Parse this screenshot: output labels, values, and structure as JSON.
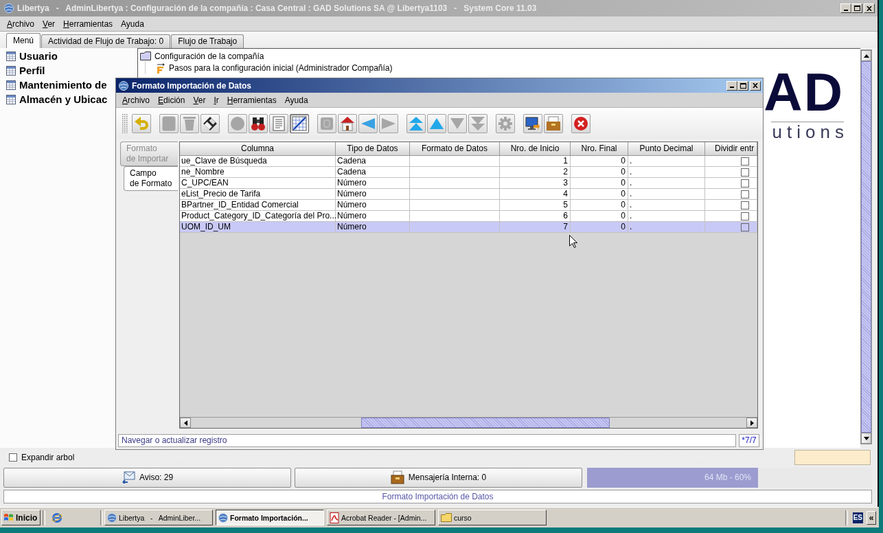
{
  "window": {
    "title": "Libertya   -   AdminLibertya : Configuración de la compañía : Casa Central : GAD Solutions SA @ Libertya1103   -   System Core 11.03",
    "active": false
  },
  "menu": [
    {
      "label": "Archivo",
      "mnemonic": true
    },
    {
      "label": "Ver",
      "mnemonic": true
    },
    {
      "label": "Herramientas",
      "mnemonic": true
    },
    {
      "label": "Ayuda",
      "mnemonic": false
    }
  ],
  "tabs": [
    {
      "label": "Menú",
      "selected": true
    },
    {
      "label": "Actividad de Flujo de Trabajo: 0",
      "selected": false
    },
    {
      "label": "Flujo de Trabajo",
      "selected": false
    }
  ],
  "sidebar": {
    "items": [
      {
        "label": "Usuario"
      },
      {
        "label": "Perfil"
      },
      {
        "label": "Mantenimiento de"
      },
      {
        "label": "Almacén y Ubicac"
      }
    ]
  },
  "tree": {
    "items": [
      {
        "label": "Configuración de la compañía",
        "kind": "folder",
        "children": [
          {
            "label": "Pasos para la configuración inicial (Administrador Compañía)",
            "kind": "workflow"
          }
        ]
      }
    ]
  },
  "logo": {
    "mark": "AD",
    "tagline": "utions"
  },
  "expand_tree": {
    "label": "Expandir arbol",
    "checked": false
  },
  "status_panels": [
    {
      "kind": "notice",
      "label": "Aviso: 29"
    },
    {
      "kind": "messages",
      "label": "Mensajería Interna: 0"
    }
  ],
  "memory": {
    "label": "64 Mb - 60%",
    "level": 0.6
  },
  "status_bar": "Formato Importación de Datos",
  "dialog": {
    "title": "Formato Importación de Datos",
    "active": true,
    "menu": [
      {
        "label": "Archivo",
        "mnemonic": true
      },
      {
        "label": "Edición",
        "mnemonic": true
      },
      {
        "label": "Ver",
        "mnemonic": true
      },
      {
        "label": "Ir",
        "mnemonic": true
      },
      {
        "label": "Herramientas",
        "mnemonic": true
      },
      {
        "label": "Ayuda",
        "mnemonic": false
      }
    ],
    "toolbar": [
      {
        "buttons": [
          {
            "kind": "undo",
            "disabled": false,
            "pressed": false
          }
        ]
      },
      {
        "buttons": [
          {
            "kind": "new",
            "disabled": true,
            "pressed": false
          },
          {
            "kind": "delete",
            "disabled": true,
            "pressed": false
          },
          {
            "kind": "save",
            "disabled": false,
            "pressed": false
          }
        ]
      },
      {
        "buttons": [
          {
            "kind": "refresh",
            "disabled": true,
            "pressed": false
          },
          {
            "kind": "find",
            "disabled": false,
            "pressed": false
          },
          {
            "kind": "history",
            "disabled": false,
            "pressed": false
          },
          {
            "kind": "grid",
            "disabled": false,
            "pressed": true
          }
        ]
      },
      {
        "buttons": [
          {
            "kind": "attachment",
            "disabled": true,
            "pressed": false
          },
          {
            "kind": "home",
            "disabled": false,
            "pressed": false
          },
          {
            "kind": "parent",
            "disabled": false,
            "pressed": false
          },
          {
            "kind": "detail",
            "disabled": true,
            "pressed": false
          }
        ]
      },
      {
        "buttons": [
          {
            "kind": "first",
            "disabled": false,
            "pressed": false
          },
          {
            "kind": "previous",
            "disabled": false,
            "pressed": false
          },
          {
            "kind": "next",
            "disabled": true,
            "pressed": false
          },
          {
            "kind": "last",
            "disabled": true,
            "pressed": false
          }
        ]
      },
      {
        "buttons": [
          {
            "kind": "process",
            "disabled": true,
            "pressed": false
          }
        ]
      },
      {
        "buttons": [
          {
            "kind": "report",
            "disabled": false,
            "pressed": false
          },
          {
            "kind": "archive",
            "disabled": false,
            "pressed": false
          }
        ]
      },
      {
        "buttons": [
          {
            "kind": "exit",
            "disabled": false,
            "pressed": false
          }
        ]
      }
    ],
    "tabs": [
      {
        "label": "Formato\nde Importar",
        "selected": false,
        "children": [
          {
            "label": "Campo\nde Formato",
            "selected": true
          }
        ]
      }
    ],
    "table": {
      "columns": [
        "Columna",
        "Tipo de Datos",
        "Formato de Datos",
        "Nro. de Inicio",
        "Nro. Final",
        "Punto Decimal",
        "Dividir entr"
      ],
      "rows": [
        {
          "column": "ue_Clave de Búsqueda",
          "data_type": "Cadena",
          "start": "1",
          "end": "0",
          "decimal_point": ".",
          "split": false,
          "selected": false
        },
        {
          "column": "ne_Nombre",
          "data_type": "Cadena",
          "start": "2",
          "end": "0",
          "decimal_point": ".",
          "split": false,
          "selected": false
        },
        {
          "column": "C_UPC/EAN",
          "data_type": "Número",
          "start": "3",
          "end": "0",
          "decimal_point": ".",
          "split": false,
          "selected": false
        },
        {
          "column": "eList_Precio de Tarifa",
          "data_type": "Número",
          "start": "4",
          "end": "0",
          "decimal_point": ".",
          "split": false,
          "selected": false
        },
        {
          "column": "BPartner_ID_Entidad Comercial",
          "data_type": "Número",
          "start": "5",
          "end": "0",
          "decimal_point": ".",
          "split": false,
          "selected": false
        },
        {
          "column": "Product_Category_ID_Categoría del Pro...",
          "data_type": "Número",
          "start": "6",
          "end": "0",
          "decimal_point": ".",
          "split": false,
          "selected": false
        },
        {
          "column": "UOM_ID_UM",
          "data_type": "Número",
          "start": "7",
          "end": "0",
          "decimal_point": ".",
          "split": false,
          "selected": true
        }
      ]
    },
    "status": {
      "message": "Navegar o actualizar registro",
      "record": "*7/7"
    }
  },
  "taskbar": {
    "start": "Inicio",
    "tasks": [
      {
        "kind": "app",
        "label": "Libertya   -   AdminLiber...",
        "selected": false
      },
      {
        "kind": "app",
        "label": "Formato Importación...",
        "selected": true
      },
      {
        "kind": "pdf",
        "label": "Acrobat Reader - [Admin...",
        "selected": false
      },
      {
        "kind": "folder",
        "label": "curso",
        "selected": false
      }
    ],
    "language": "ES",
    "tray_toggle": "«"
  }
}
